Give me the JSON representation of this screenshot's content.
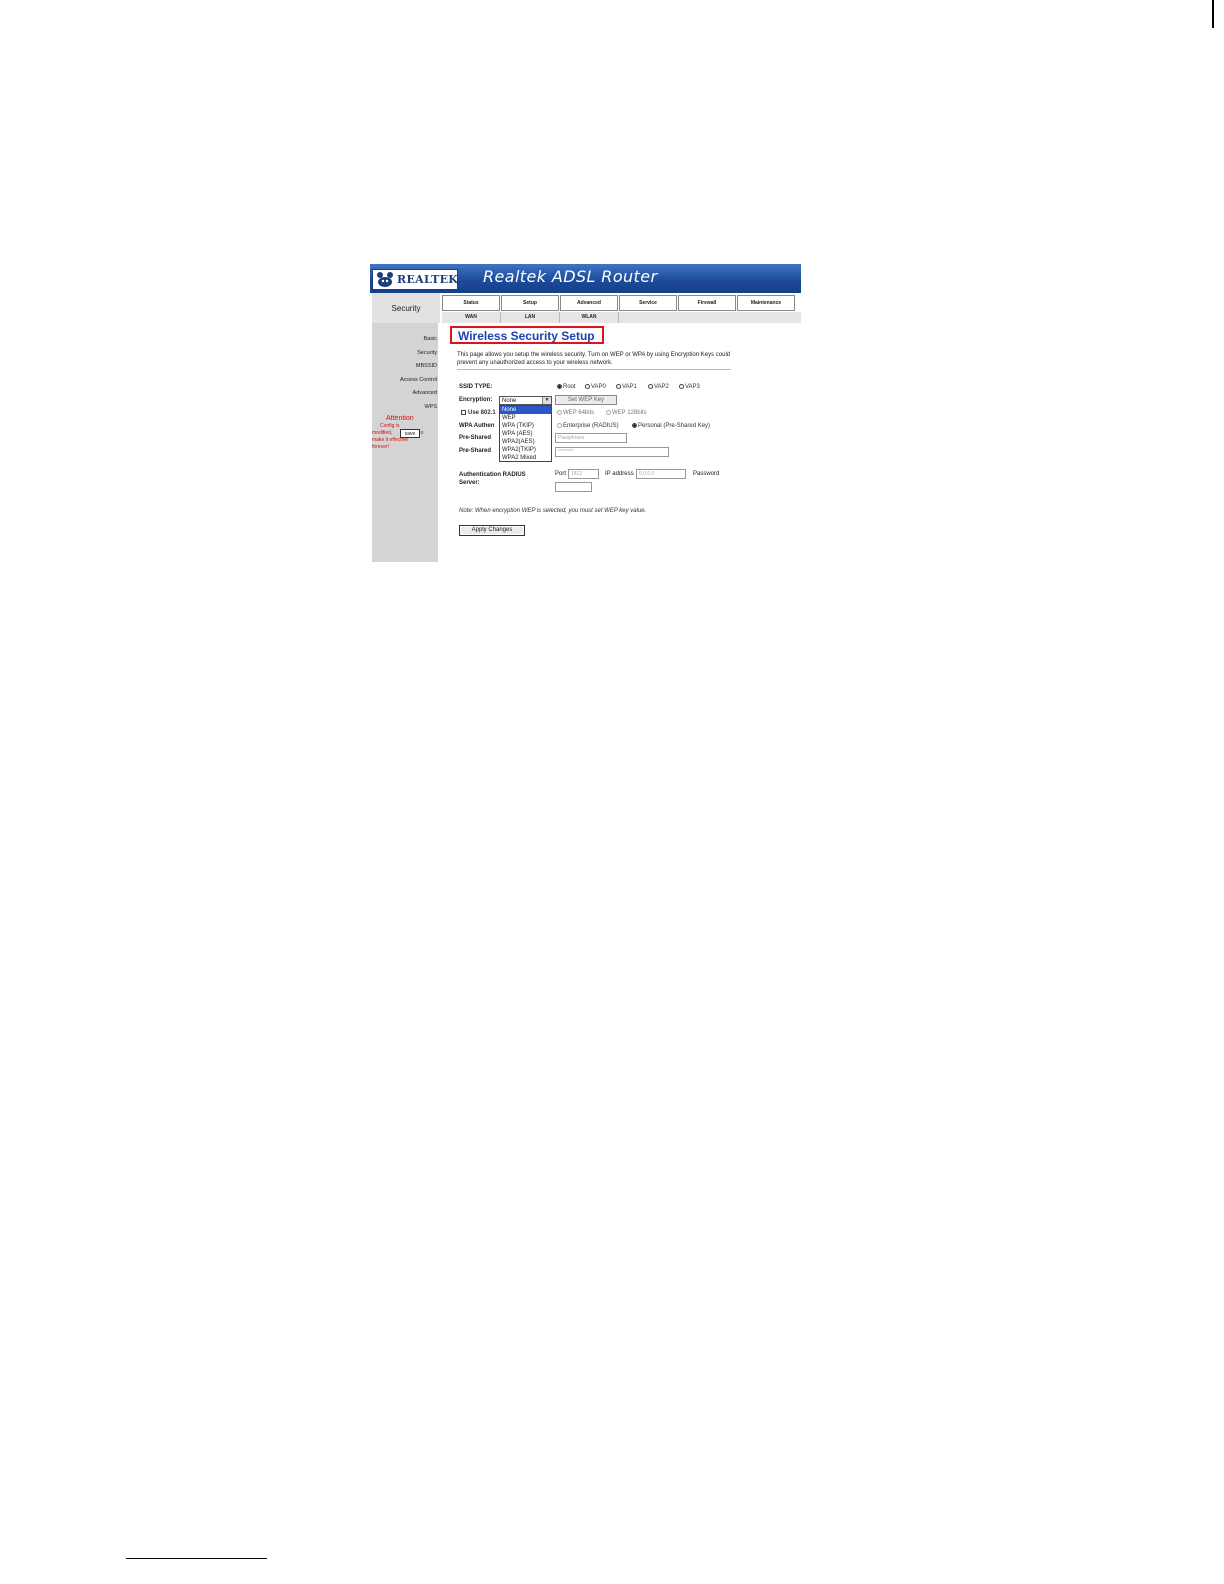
{
  "banner": {
    "logo_text": "REALTEK",
    "title": "Realtek ADSL Router"
  },
  "section": {
    "label": "Security"
  },
  "tabs_top": [
    "Status",
    "Setup",
    "Advanced",
    "Service",
    "Firewall",
    "Maintenance"
  ],
  "tabs_sub": [
    "WAN",
    "LAN",
    "WLAN"
  ],
  "side_menu": [
    "Basic",
    "Security",
    "MBSSID",
    "Access Control",
    "Advanced",
    "WPS"
  ],
  "attention": {
    "title": "Attention",
    "line1": "Config is",
    "line2_pre": "modified,",
    "save_label": "save",
    "line2_post": "it to",
    "line3": "make it effective",
    "line4": "forever!"
  },
  "page": {
    "title": "Wireless Security Setup",
    "description": "This page allows you setup the wireless security. Turn on WEP or WPA by using Encryption Keys could prevent any unauthorized access to your wireless network."
  },
  "form": {
    "ssid_type_label": "SSID TYPE:",
    "ssid_options": [
      "Root",
      "VAP0",
      "VAP1",
      "VAP2",
      "VAP3"
    ],
    "encryption_label": "Encryption:",
    "encryption_value": "None",
    "encryption_options": [
      "None",
      "WEP",
      "WPA (TKIP)",
      "WPA (AES)",
      "WPA2(AES)",
      "WPA2(TKIP)",
      "WPA2 Mixed"
    ],
    "set_wep_key_label": "Set WEP Key",
    "use_8021x_label": "Use 802.1",
    "wep_64": "WEP 64bits",
    "wep_128": "WEP 128bits",
    "wpa_auth_label": "WPA Authen",
    "wpa_enterprise": "Enterprise (RADIUS)",
    "wpa_personal": "Personal (Pre-Shared Key)",
    "psk_format_label": "Pre-Shared",
    "psk_format_value": "Passphrase",
    "psk_label": "Pre-Shared",
    "psk_value": "********",
    "radius_label_1": "Authentication RADIUS",
    "radius_label_2": "Server:",
    "port_label": "Port",
    "port_value": "1812",
    "ip_label": "IP address",
    "ip_value": "0.0.0.0",
    "password_label": "Password",
    "note": "Note: When encryption WEP is selected, you must set WEP key value.",
    "apply_label": "Apply Changes"
  }
}
